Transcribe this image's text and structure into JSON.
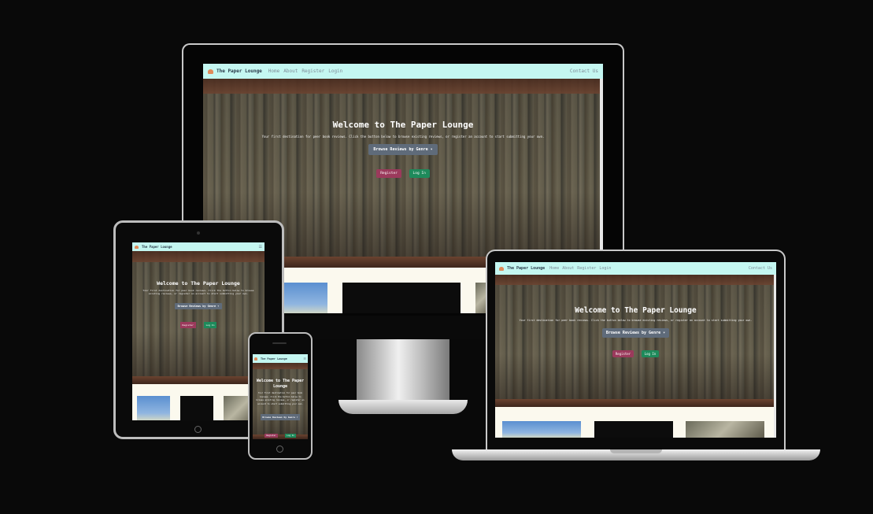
{
  "site": {
    "brand": "The Paper Lounge",
    "nav": {
      "home": "Home",
      "about": "About",
      "register": "Register",
      "login": "Login",
      "contact": "Contact Us"
    },
    "hero": {
      "title": "Welcome to The Paper Lounge",
      "subtitle": "Your first destination for peer book reviews. Click the button below to browse existing reviews, or register an account to start submitting your own.",
      "dropdown": "Browse Reviews by Genre",
      "register": "Register",
      "login": "Log In"
    },
    "icons": {
      "logo": "book-logo-icon",
      "menu": "hamburger-menu-icon",
      "caret": "caret-down-icon"
    }
  },
  "colors": {
    "navbar": "#c4f7f1",
    "register": "#9b3a5c",
    "login": "#1e8a5b",
    "dropdown": "#5f6b7a",
    "background": "#090909"
  }
}
